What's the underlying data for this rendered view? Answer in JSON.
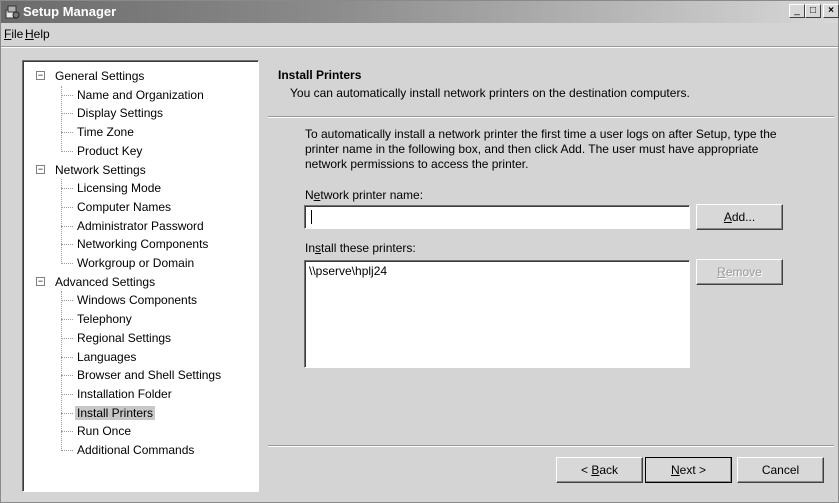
{
  "window": {
    "title": "Setup Manager",
    "minimize": "_",
    "maximize": "□",
    "close": "×"
  },
  "menu": {
    "file_prefix": "",
    "file_accel": "F",
    "file_rest": "ile",
    "help_accel": "H",
    "help_rest": "elp"
  },
  "tree": {
    "groups": [
      {
        "label": "General Settings",
        "children": [
          "Name and Organization",
          "Display Settings",
          "Time Zone",
          "Product Key"
        ]
      },
      {
        "label": "Network Settings",
        "children": [
          "Licensing Mode",
          "Computer Names",
          "Administrator Password",
          "Networking Components",
          "Workgroup or Domain"
        ]
      },
      {
        "label": "Advanced Settings",
        "children": [
          "Windows Components",
          "Telephony",
          "Regional Settings",
          "Languages",
          "Browser and Shell Settings",
          "Installation Folder",
          "Install Printers",
          "Run Once",
          "Additional Commands"
        ]
      }
    ],
    "selected": "Install Printers",
    "expander_symbol": "−"
  },
  "page": {
    "heading": "Install Printers",
    "subheading": "You can automatically install network printers on the destination computers.",
    "instructions": "To automatically install a network printer the first time a user logs on after Setup, type the printer name in the following box, and then click Add. The user must have appropriate network permissions to access the printer.",
    "printer_label_pre": "N",
    "printer_label_accel": "e",
    "printer_label_post": "twork printer name:",
    "printer_value": "",
    "install_label_pre": "In",
    "install_label_accel": "s",
    "install_label_post": "tall these printers:",
    "printers": [
      "\\\\pserve\\hplj24"
    ]
  },
  "buttons": {
    "add_accel": "A",
    "add_rest": "dd...",
    "remove_accel": "R",
    "remove_rest": "emove",
    "back_pre": "< ",
    "back_accel": "B",
    "back_rest": "ack",
    "next_accel": "N",
    "next_rest": "ext >",
    "cancel": "Cancel"
  }
}
